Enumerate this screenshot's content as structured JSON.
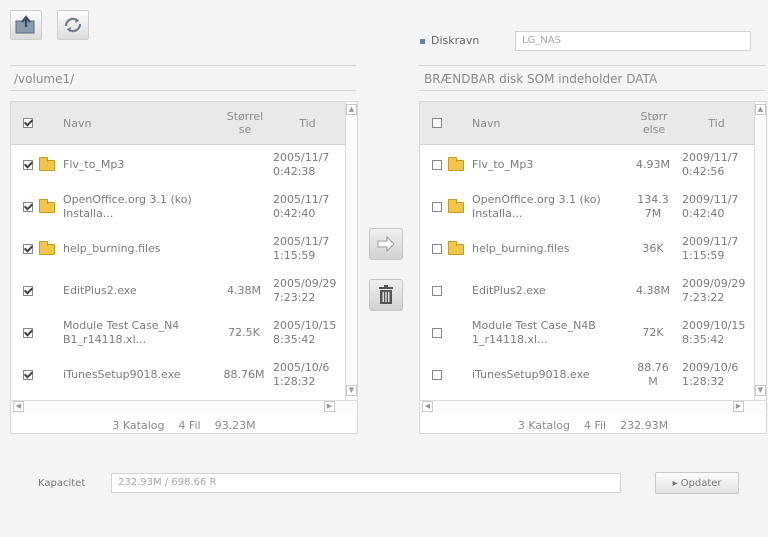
{
  "toolbar": {
    "upload_icon": "folder-upload-icon",
    "refresh_icon": "refresh-icon"
  },
  "disk": {
    "label": "Diskravn",
    "name": "LG_NAS"
  },
  "left_panel": {
    "path": "/volume1/",
    "columns": [
      "Navn",
      "Størrel\nse",
      "Tid"
    ],
    "header_checked": true,
    "rows": [
      {
        "checked": true,
        "folder": true,
        "name": "Flv_to_Mp3",
        "size": "",
        "time": "2005/11/7\n0:42:38"
      },
      {
        "checked": true,
        "folder": true,
        "name": "OpenOffice.org 3.1 (ko)\nInstalla...",
        "size": "",
        "time": "2005/11/7\n0:42:40"
      },
      {
        "checked": true,
        "folder": true,
        "name": "help_burning.files",
        "size": "",
        "time": "2005/11/7\n1:15:59"
      },
      {
        "checked": true,
        "folder": false,
        "name": "EditPlus2.exe",
        "size": "4.38M",
        "time": "2005/09/29\n7:23:22"
      },
      {
        "checked": true,
        "folder": false,
        "name": "Module Test Case_N4\nB1_r14118.xl...",
        "size": "72.5K",
        "time": "2005/10/15\n8:35:42"
      },
      {
        "checked": true,
        "folder": false,
        "name": "iTunesSetup9018.exe",
        "size": "88.76M",
        "time": "2005/10/6\n1:28:32"
      }
    ],
    "footer": {
      "dirs": "3 Katalog",
      "files": "4 Fil",
      "size": "93.23M"
    }
  },
  "right_panel": {
    "path": "BRÆNDBAR disk SOM indeholder DATA",
    "columns": [
      "Navn",
      "Størr\nelse",
      "Tid"
    ],
    "header_checked": false,
    "rows": [
      {
        "checked": false,
        "folder": true,
        "name": "Flv_to_Mp3",
        "size": "4.93M",
        "time": "2009/11/7\n0:42:56"
      },
      {
        "checked": false,
        "folder": true,
        "name": "OpenOffice.org 3.1 (ko)\nInstalla...",
        "size": "134.3\n7M",
        "time": "2009/11/7\n0:42:40"
      },
      {
        "checked": false,
        "folder": true,
        "name": "help_burning.files",
        "size": "36K",
        "time": "2009/11/7\n1:15:59"
      },
      {
        "checked": false,
        "folder": false,
        "name": "EditPlus2.exe",
        "size": "4.38M",
        "time": "2009/09/29\n7:23:22"
      },
      {
        "checked": false,
        "folder": false,
        "name": "Module Test Case_N4B\n1_r14118.xl...",
        "size": "72K",
        "time": "2009/10/15\n8:35:42"
      },
      {
        "checked": false,
        "folder": false,
        "name": "iTunesSetup9018.exe",
        "size": "88.76\nM",
        "time": "2009/10/6\n1:28:32"
      }
    ],
    "footer": {
      "dirs": "3 Katalog",
      "files": "4 Fil",
      "size": "232.93M"
    }
  },
  "actions": {
    "copy_icon": "arrow-right-icon",
    "delete_icon": "trash-icon"
  },
  "capacity": {
    "label": "Kapacitet",
    "value": "232.93M / 698.66 R",
    "refresh_button": "▸ Opdater"
  }
}
